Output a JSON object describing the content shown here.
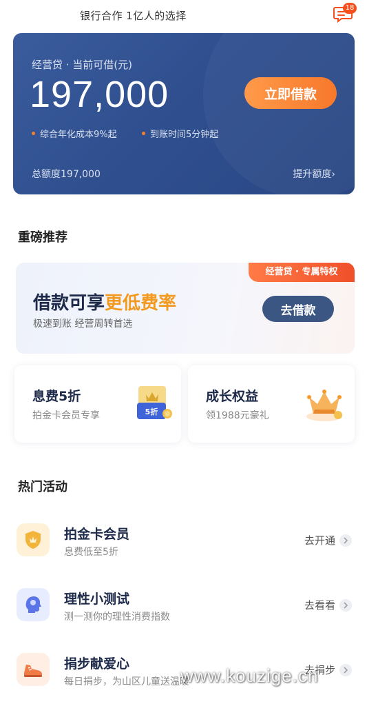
{
  "header": {
    "title": "银行合作 1亿人的选择",
    "message_badge": "18",
    "message_icon": "chat-bubble-icon"
  },
  "credit_card": {
    "label": "经营贷 · 当前可借(元)",
    "amount": "197,000",
    "borrow_button": "立即借款",
    "features": [
      "综合年化成本9%起",
      "到账时间5分钟起"
    ],
    "total_limit": "总额度197,000",
    "raise_limit": "提升额度",
    "raise_chevron": "›",
    "colors": {
      "background": "#2f4f8f",
      "button": "#f7782b",
      "dot": "#f7822e"
    }
  },
  "recommend": {
    "section_title": "重磅推荐",
    "banner": {
      "tag": "经营贷 · 专属特权",
      "headline_prefix": "借款可享",
      "headline_highlight": "更低费率",
      "subtitle": "极速到账 经营周转首选",
      "button": "去借款"
    },
    "cards": [
      {
        "title": "息费5折",
        "subtitle": "拍金卡会员专享",
        "icon": "discount-coupon-icon",
        "icon_text": "5折"
      },
      {
        "title": "成长权益",
        "subtitle": "领1988元豪礼",
        "icon": "crown-icon"
      }
    ]
  },
  "hot": {
    "section_title": "热门活动",
    "items": [
      {
        "title": "拍金卡会员",
        "subtitle": "息费低至5折",
        "action": "去开通",
        "icon": "gold-shield-icon"
      },
      {
        "title": "理性小测试",
        "subtitle": "测一测你的理性消费指数",
        "action": "去看看",
        "icon": "head-profile-icon"
      },
      {
        "title": "捐步献爱心",
        "subtitle": "每日捐步，为山区儿童送温暖",
        "action": "去捐步",
        "icon": "sneaker-icon"
      }
    ]
  },
  "watermark": "www.kouzige.cn"
}
